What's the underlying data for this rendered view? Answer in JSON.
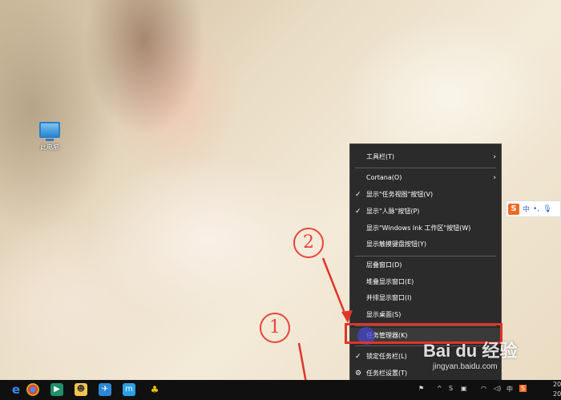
{
  "desktop": {
    "icon_label": "此电脑"
  },
  "context_menu": {
    "items": [
      {
        "label": "工具栏(T)",
        "checked": false,
        "submenu": true
      },
      {
        "label": "Cortana(O)",
        "checked": false,
        "submenu": true
      },
      {
        "label": "显示\"任务视图\"按钮(V)",
        "checked": true,
        "submenu": false
      },
      {
        "label": "显示\"人脉\"按钮(P)",
        "checked": true,
        "submenu": false
      },
      {
        "label": "显示\"Windows Ink 工作区\"按钮(W)",
        "checked": false,
        "submenu": false
      },
      {
        "label": "显示触摸键盘按钮(Y)",
        "checked": false,
        "submenu": false
      },
      {
        "label": "层叠窗口(D)",
        "checked": false,
        "submenu": false
      },
      {
        "label": "堆叠显示窗口(E)",
        "checked": false,
        "submenu": false
      },
      {
        "label": "并排显示窗口(I)",
        "checked": false,
        "submenu": false
      },
      {
        "label": "显示桌面(S)",
        "checked": false,
        "submenu": false
      },
      {
        "label": "任务管理器(K)",
        "checked": false,
        "submenu": false,
        "highlighted": true
      },
      {
        "label": "锁定任务栏(L)",
        "checked": true,
        "submenu": false
      },
      {
        "label": "任务栏设置(T)",
        "checked": false,
        "submenu": false,
        "icon": "gear-icon"
      }
    ]
  },
  "annotations": {
    "step1": "1",
    "step2": "2",
    "color": "#e0342a"
  },
  "ime": {
    "logo": "S",
    "mode": "中",
    "punct": "•,"
  },
  "taskbar": {
    "icons": [
      "edge-icon",
      "chrome-icon",
      "media-player-icon",
      "app-icon",
      "feather-app-icon",
      "m-app-icon",
      "qq-icon"
    ],
    "tray_text": "20",
    "tray_text2": "20"
  },
  "watermark": {
    "logo": "Bai du 经验",
    "url": "jingyan.baidu.com"
  }
}
